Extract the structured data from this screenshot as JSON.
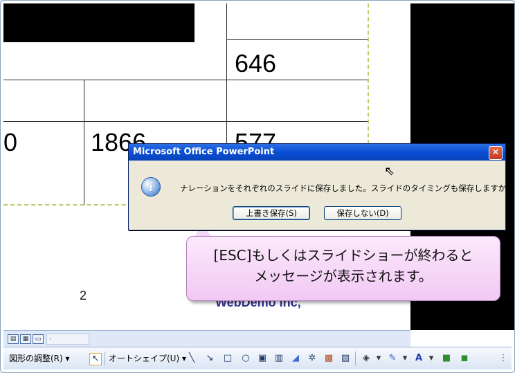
{
  "slide": {
    "cells": [
      "646",
      "0",
      "1866",
      "577"
    ],
    "page_number": "2",
    "company_text": "WebDemo Inc,"
  },
  "dialog": {
    "title": "Microsoft Office PowerPoint",
    "close_glyph": "✕",
    "icon_glyph": "i",
    "message": "ナレーションをそれぞれのスライドに保存しました。スライドのタイミングも保存しますか?",
    "buttons": {
      "overwrite": "上書き保存(S)",
      "dont_save": "保存しない(D)"
    }
  },
  "callout": {
    "line1": "[ESC]もしくはスライドショーが終わると",
    "line2": "メッセージが表示されます。"
  },
  "toolbar": {
    "draw_menu": "図形の調整(R) ▾",
    "autoshape_menu": "オートシェイプ(U) ▾"
  },
  "colors": {
    "title_bar": "#0a4fd6",
    "dialog_bg": "#ece9d8",
    "callout_bg": "#f2c8f4",
    "guide_dash": "#b7cf6b"
  }
}
